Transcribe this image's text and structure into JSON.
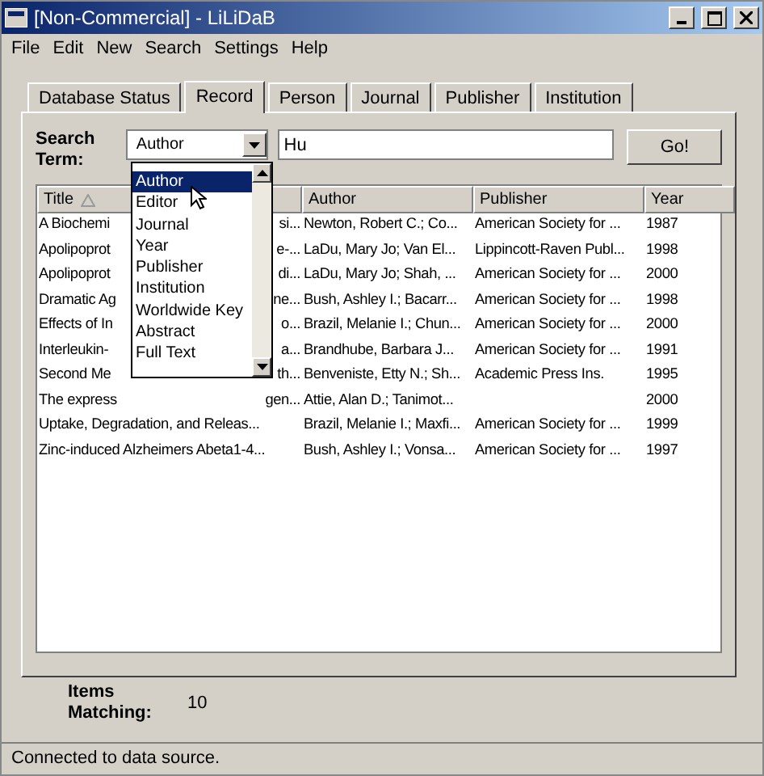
{
  "window": {
    "title": "[Non-Commercial] - LiLiDaB"
  },
  "menu": [
    "File",
    "Edit",
    "New",
    "Search",
    "Settings",
    "Help"
  ],
  "tabs": [
    {
      "label": "Database Status",
      "selected": false
    },
    {
      "label": "Record",
      "selected": true
    },
    {
      "label": "Person",
      "selected": false
    },
    {
      "label": "Journal",
      "selected": false
    },
    {
      "label": "Publisher",
      "selected": false
    },
    {
      "label": "Institution",
      "selected": false
    }
  ],
  "search": {
    "label": "Search Term:",
    "field": "Author",
    "value": "Hu",
    "button": "Go!"
  },
  "dropdown": {
    "options": [
      {
        "label": "Author",
        "selected": true
      },
      {
        "label": "Editor",
        "selected": false
      },
      {
        "label": "Journal",
        "selected": false
      },
      {
        "label": "Year",
        "selected": false
      },
      {
        "label": "Publisher",
        "selected": false
      },
      {
        "label": "Institution",
        "selected": false
      },
      {
        "label": "Worldwide Key",
        "selected": false
      },
      {
        "label": "Abstract",
        "selected": false
      },
      {
        "label": "Full Text",
        "selected": false
      }
    ]
  },
  "table": {
    "columns": [
      "Title",
      "Author",
      "Publisher",
      "Year"
    ],
    "rows": [
      {
        "title_start": "A Biochemi",
        "title_end": "si...",
        "author": "Newton, Robert C.; Co...",
        "publisher": "American Society for ...",
        "year": "1987"
      },
      {
        "title_start": "Apolipoprot",
        "title_end": "e-...",
        "author": "LaDu, Mary Jo; Van El...",
        "publisher": "Lippincott-Raven Publ...",
        "year": "1998"
      },
      {
        "title_start": "Apolipoprot",
        "title_end": "di...",
        "author": "LaDu, Mary Jo; Shah, ...",
        "publisher": "American Society for ...",
        "year": "2000"
      },
      {
        "title_start": "Dramatic Ag",
        "title_end": "ne...",
        "author": "Bush, Ashley I.; Bacarr...",
        "publisher": "American Society for ...",
        "year": "1998"
      },
      {
        "title_start": "Effects of In",
        "title_end": "o...",
        "author": "Brazil, Melanie I.; Chun...",
        "publisher": "American Society for ...",
        "year": "2000"
      },
      {
        "title_start": "Interleukin-",
        "title_end": "a...",
        "author": "Brandhube, Barbara J...",
        "publisher": "American Society for ...",
        "year": "1991"
      },
      {
        "title_start": "Second Me",
        "title_end": "th...",
        "author": "Benveniste, Etty N.; Sh...",
        "publisher": "Academic Press Ins.",
        "year": "1995"
      },
      {
        "title_start": "The express",
        "title_end": "gen...",
        "author": "Attie, Alan D.; Tanimot...",
        "year": "2000"
      },
      {
        "title_start": "Uptake, Degradation, and Releas...",
        "author": "Brazil, Melanie I.; Maxfi...",
        "publisher": "American Society for ...",
        "year": "1999"
      },
      {
        "title_start": "Zinc-induced Alzheimers Abeta1-4...",
        "author": "Bush, Ashley I.; Vonsa...",
        "publisher": "American Society for ...",
        "year": "1997"
      }
    ]
  },
  "items_matching": {
    "label": "Items Matching:",
    "value": "10"
  },
  "status_bar": "Connected to data source."
}
